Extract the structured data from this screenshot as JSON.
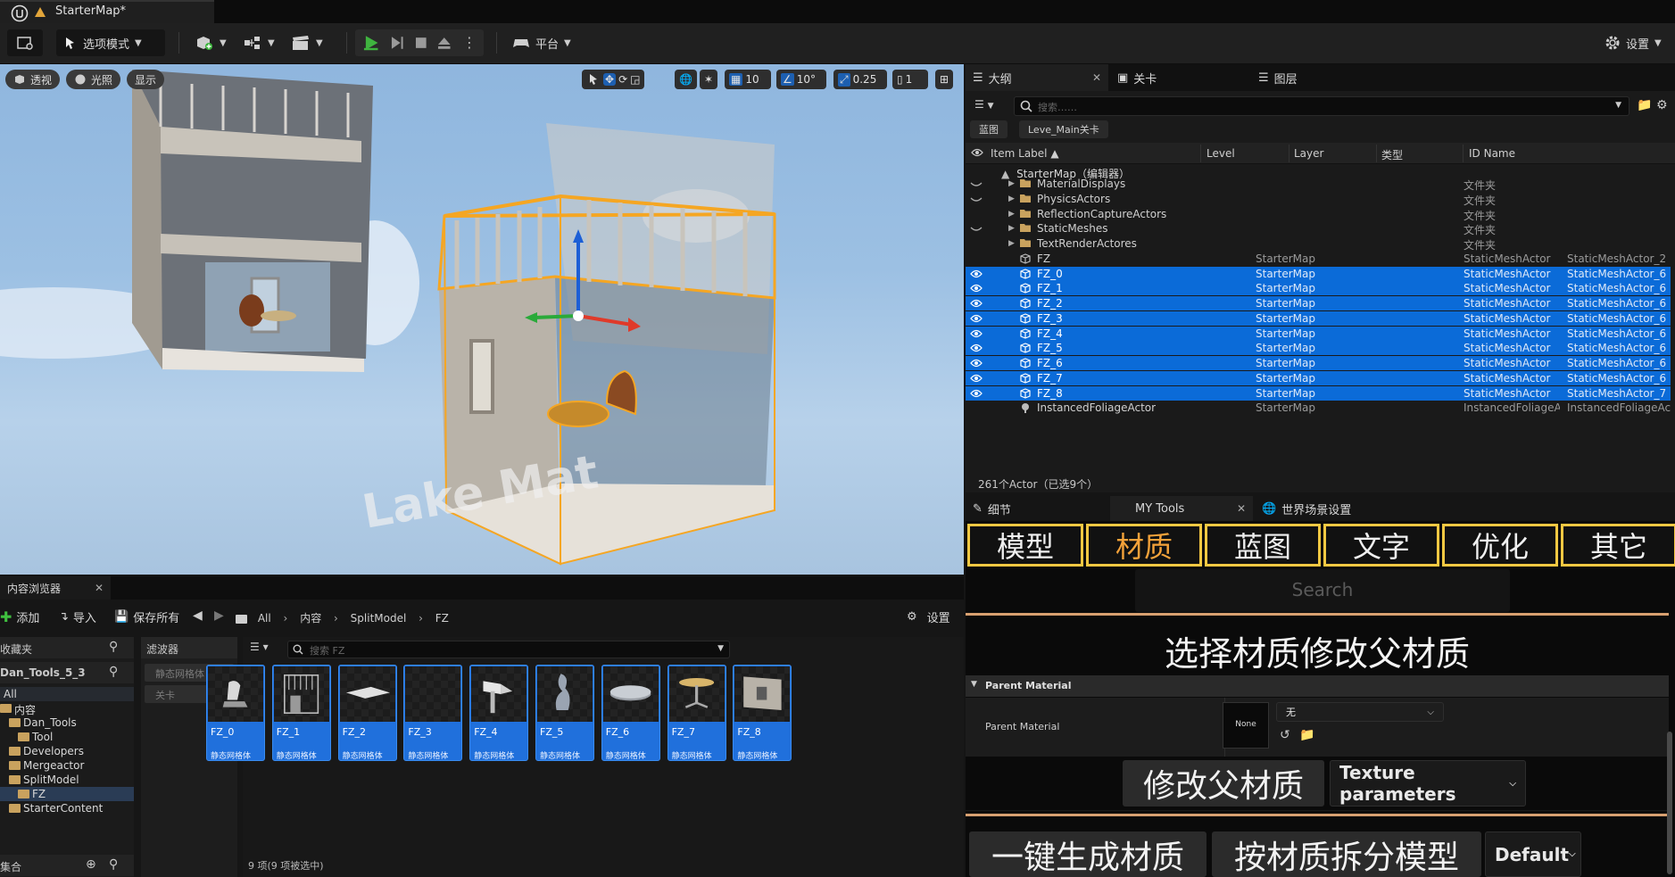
{
  "app": {
    "map_tab_title": "StarterMap*"
  },
  "toolbar": {
    "mode_label": "选项模式",
    "platform_label": "平台",
    "settings_label": "设置"
  },
  "viewport": {
    "perspective_label": "透视",
    "lighting_label": "光照",
    "show_label": "显示",
    "grid_snap_value": "10",
    "rotate_snap_value": "10°",
    "scale_snap_value": "0.25",
    "camera_speed_value": "1",
    "scene_text": "Lake Mat"
  },
  "outliner": {
    "tabs": [
      {
        "label": "大纲"
      },
      {
        "label": "关卡"
      },
      {
        "label": "图层"
      }
    ],
    "search_placeholder": "搜索……",
    "chips": [
      "蓝图",
      "Leve_Main关卡"
    ],
    "columns": {
      "item_label": "Item Label ▲",
      "level": "Level",
      "layer": "Layer",
      "type": "类型",
      "id_name": "ID Name"
    },
    "root_label": "StarterMap（编辑器）",
    "rows": [
      {
        "label": "MaterialDisplays",
        "level": "",
        "type": "文件夹",
        "id": "",
        "kind": "folder",
        "selected": false
      },
      {
        "label": "PhysicsActors",
        "level": "",
        "type": "文件夹",
        "id": "",
        "kind": "folder",
        "selected": false
      },
      {
        "label": "ReflectionCaptureActors",
        "level": "",
        "type": "文件夹",
        "id": "",
        "kind": "folder",
        "selected": false
      },
      {
        "label": "StaticMeshes",
        "level": "",
        "type": "文件夹",
        "id": "",
        "kind": "folder",
        "selected": false
      },
      {
        "label": "TextRenderActores",
        "level": "",
        "type": "文件夹",
        "id": "",
        "kind": "folder",
        "selected": false
      },
      {
        "label": "FZ",
        "level": "StarterMap",
        "type": "StaticMeshActor",
        "id": "StaticMeshActor_2",
        "kind": "mesh",
        "selected": false
      },
      {
        "label": "FZ_0",
        "level": "StarterMap",
        "type": "StaticMeshActor",
        "id": "StaticMeshActor_6",
        "kind": "mesh",
        "selected": true
      },
      {
        "label": "FZ_1",
        "level": "StarterMap",
        "type": "StaticMeshActor",
        "id": "StaticMeshActor_6",
        "kind": "mesh",
        "selected": true
      },
      {
        "label": "FZ_2",
        "level": "StarterMap",
        "type": "StaticMeshActor",
        "id": "StaticMeshActor_6",
        "kind": "mesh",
        "selected": true
      },
      {
        "label": "FZ_3",
        "level": "StarterMap",
        "type": "StaticMeshActor",
        "id": "StaticMeshActor_6",
        "kind": "mesh",
        "selected": true
      },
      {
        "label": "FZ_4",
        "level": "StarterMap",
        "type": "StaticMeshActor",
        "id": "StaticMeshActor_6",
        "kind": "mesh",
        "selected": true
      },
      {
        "label": "FZ_5",
        "level": "StarterMap",
        "type": "StaticMeshActor",
        "id": "StaticMeshActor_6",
        "kind": "mesh",
        "selected": true
      },
      {
        "label": "FZ_6",
        "level": "StarterMap",
        "type": "StaticMeshActor",
        "id": "StaticMeshActor_6",
        "kind": "mesh",
        "selected": true
      },
      {
        "label": "FZ_7",
        "level": "StarterMap",
        "type": "StaticMeshActor",
        "id": "StaticMeshActor_6",
        "kind": "mesh",
        "selected": true
      },
      {
        "label": "FZ_8",
        "level": "StarterMap",
        "type": "StaticMeshActor",
        "id": "StaticMeshActor_7",
        "kind": "mesh",
        "selected": true
      },
      {
        "label": "InstancedFoliageActor",
        "level": "StarterMap",
        "type": "InstancedFoliageAc",
        "id": "InstancedFoliageAc",
        "kind": "foliage",
        "selected": false
      }
    ],
    "status": "261个Actor（已选9个）"
  },
  "details": {
    "tabs": [
      {
        "label": "细节"
      },
      {
        "label": "MY Tools"
      },
      {
        "label": "世界场景设置"
      }
    ],
    "categories": [
      "模型",
      "材质",
      "蓝图",
      "文字",
      "优化",
      "其它"
    ],
    "active_category": "材质",
    "search_placeholder": "Search",
    "heading": "选择材质修改父材质",
    "section_title": "Parent Material",
    "property_label": "Parent Material",
    "thumb_label": "None",
    "material_value": "无",
    "modify_button": "修改父材质",
    "param_dropdown": "Texture parameters",
    "generate_button": "一键生成材质",
    "split_button": "按材质拆分模型",
    "default_dropdown": "Default"
  },
  "content_browser": {
    "tab_label": "内容浏览器",
    "add_label": "添加",
    "import_label": "导入",
    "save_all_label": "保存所有",
    "breadcrumb": [
      "All",
      "内容",
      "SplitModel",
      "FZ"
    ],
    "settings_label": "设置",
    "favorites_label": "收藏夹",
    "project_label": "Dan_Tools_5_3",
    "tree": [
      {
        "label": "All",
        "depth": 0
      },
      {
        "label": "内容",
        "depth": 0
      },
      {
        "label": "Dan_Tools",
        "depth": 1
      },
      {
        "label": "Tool",
        "depth": 2
      },
      {
        "label": "Developers",
        "depth": 1
      },
      {
        "label": "Mergeactor",
        "depth": 1
      },
      {
        "label": "SplitModel",
        "depth": 1
      },
      {
        "label": "FZ",
        "depth": 2
      },
      {
        "label": "StarterContent",
        "depth": 1
      }
    ],
    "collections_label": "集合",
    "filters_label": "滤波器",
    "filter_chips": [
      "静态网格体",
      "关卡"
    ],
    "search_placeholder": "搜索 FZ",
    "assets": [
      {
        "name": "FZ_0",
        "type": "静态网格体"
      },
      {
        "name": "FZ_1",
        "type": "静态网格体"
      },
      {
        "name": "FZ_2",
        "type": "静态网格体"
      },
      {
        "name": "FZ_3",
        "type": "静态网格体"
      },
      {
        "name": "FZ_4",
        "type": "静态网格体"
      },
      {
        "name": "FZ_5",
        "type": "静态网格体"
      },
      {
        "name": "FZ_6",
        "type": "静态网格体"
      },
      {
        "name": "FZ_7",
        "type": "静态网格体"
      },
      {
        "name": "FZ_8",
        "type": "静态网格体"
      }
    ],
    "status": "9 项(9 项被选中)"
  },
  "colors": {
    "selection_blue": "#0b6bd8",
    "category_border": "#f4c842",
    "active_category_text": "#f4a23a",
    "orange_rule": "#d8a070"
  }
}
